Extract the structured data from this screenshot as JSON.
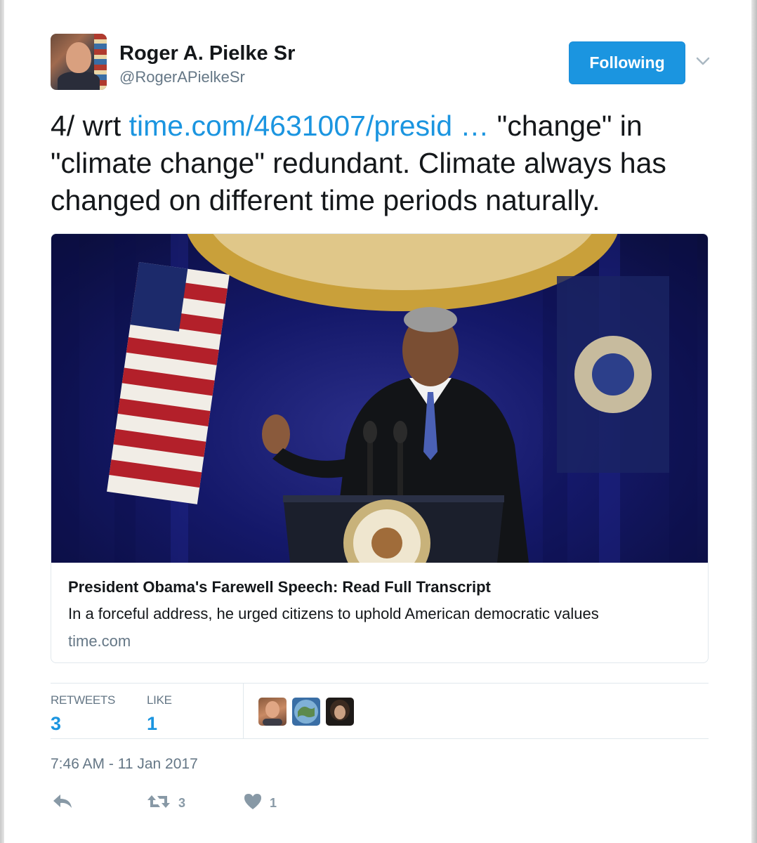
{
  "author": {
    "display_name": "Roger A. Pielke Sr",
    "handle": "@RogerAPielkeSr"
  },
  "follow_button": {
    "label": "Following"
  },
  "tweet": {
    "text_prefix": "4/ wrt ",
    "link_text": "time.com/4631007/presid …",
    "text_suffix": " \"change\" in \"climate change\" redundant. Climate always has changed on different time periods naturally."
  },
  "card": {
    "title": "President Obama's Farewell Speech: Read Full Transcript",
    "description": "In a forceful address, he urged citizens to uphold American democratic values",
    "domain": "time.com"
  },
  "stats": {
    "retweets_label": "RETWEETS",
    "retweets_value": "3",
    "likes_label": "LIKE",
    "likes_value": "1"
  },
  "timestamp": "7:46 AM - 11 Jan 2017",
  "actions": {
    "retweet_count": "3",
    "like_count": "1"
  },
  "colors": {
    "accent": "#1b95e0",
    "muted": "#657786",
    "icon": "#8899a6"
  },
  "icons": [
    "chevron-down-icon",
    "reply-icon",
    "retweet-icon",
    "heart-icon"
  ]
}
